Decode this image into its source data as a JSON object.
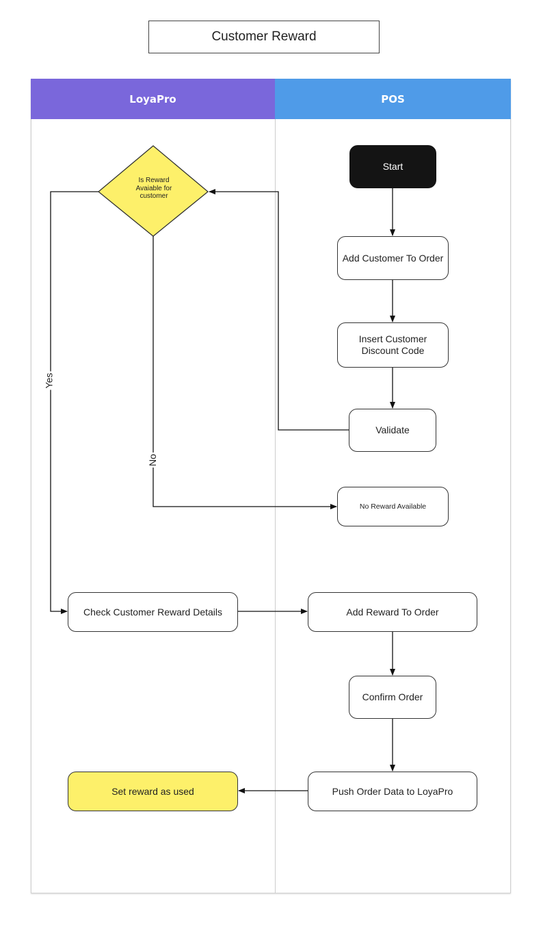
{
  "title": "Customer Reward",
  "lanes": [
    {
      "name": "LoyaPro",
      "color": "#7a67db"
    },
    {
      "name": "POS",
      "color": "#4f9be8"
    }
  ],
  "nodes": {
    "start": "Start",
    "add_customer": "Add Customer To Order",
    "insert_code": "Insert Customer Discount Code",
    "validate": "Validate",
    "decision": "Is Reward Avaiable for customer",
    "no_reward": "No Reward Available",
    "check_details": "Check Customer Reward Details",
    "add_reward": "Add Reward To Order",
    "confirm_order": "Confirm Order",
    "push_order": "Push Order Data to LoyaPro",
    "set_used": "Set reward as used"
  },
  "edge_labels": {
    "yes": "Yes",
    "no": "No"
  },
  "colors": {
    "decision_fill": "#fdf06a",
    "start_fill": "#141414",
    "final_fill": "#fdf06a"
  }
}
